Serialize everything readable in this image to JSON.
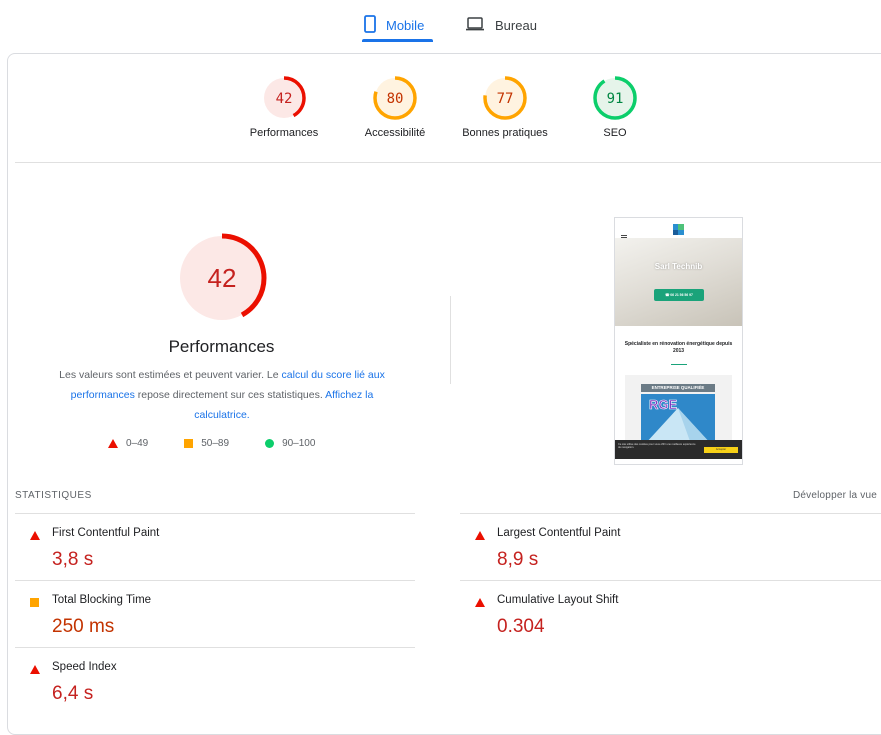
{
  "tabs": {
    "mobile": "Mobile",
    "desktop": "Bureau"
  },
  "gauges": [
    {
      "score": "42",
      "label": "Performances",
      "fraction": 0.42,
      "color": "#eb0f00",
      "bg": "#fce8e6"
    },
    {
      "score": "80",
      "label": "Accessibilité",
      "fraction": 0.8,
      "color": "#ffa400",
      "bg": "#fff3e0"
    },
    {
      "score": "77",
      "label": "Bonnes pratiques",
      "fraction": 0.77,
      "color": "#ffa400",
      "bg": "#fff3e0"
    },
    {
      "score": "91",
      "label": "SEO",
      "fraction": 0.91,
      "color": "#0cce6b",
      "bg": "#e6f4ea"
    }
  ],
  "performance": {
    "score": "42",
    "fraction": 0.42,
    "title": "Performances",
    "desc_part1": "Les valeurs sont estimées et peuvent varier. Le ",
    "desc_link1": "calcul du score lié aux performances",
    "desc_part2": " repose directement sur ces statistiques. ",
    "desc_link2": "Affichez la calculatrice.",
    "legend": [
      {
        "range": "0–49",
        "kind": "fail"
      },
      {
        "range": "50–89",
        "kind": "average"
      },
      {
        "range": "90–100",
        "kind": "pass"
      }
    ]
  },
  "preview": {
    "hero_title": "Sarl Technib",
    "button_label": "☎ 06 21 56 56 97",
    "subtitle": "Spécialiste en rénovation énergétique depuis 2013",
    "rge_banner": "ENTREPRISE QUALIFIÉE",
    "rge_logo": "RGE",
    "cookie_text": "Ce site utilise des cookies pour vous offrir une meilleure expérience de navigation.",
    "cookie_button": "Accepter"
  },
  "stats": {
    "title": "STATISTIQUES",
    "expand": "Développer la vue",
    "metrics": [
      {
        "label": "First Contentful Paint",
        "value": "3,8 s",
        "status": "fail"
      },
      {
        "label": "Largest Contentful Paint",
        "value": "8,9 s",
        "status": "fail"
      },
      {
        "label": "Total Blocking Time",
        "value": "250 ms",
        "status": "average"
      },
      {
        "label": "Cumulative Layout Shift",
        "value": "0.304",
        "status": "fail"
      },
      {
        "label": "Speed Index",
        "value": "6,4 s",
        "status": "fail"
      }
    ]
  },
  "colors": {
    "accent": "#1a73e8",
    "fail": "#eb0f00",
    "average": "#ffa400",
    "pass": "#0cce6b"
  }
}
